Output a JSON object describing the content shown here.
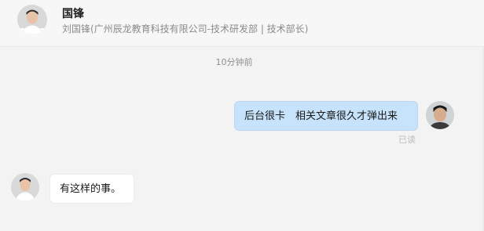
{
  "header": {
    "contact_name": "国锋",
    "contact_org": "刘国锋(广州辰龙教育科技有限公司-技术研发部 | 技术部长)"
  },
  "chat": {
    "timestamp": "10分钟前",
    "messages": [
      {
        "direction": "outgoing",
        "text": "后台很卡　相关文章很久才弹出来",
        "status": "已读"
      },
      {
        "direction": "incoming",
        "text": "有这样的事。"
      }
    ]
  },
  "colors": {
    "outgoing_bubble": "#c6e3fb",
    "incoming_bubble": "#ffffff",
    "background": "#f3f3f3"
  }
}
